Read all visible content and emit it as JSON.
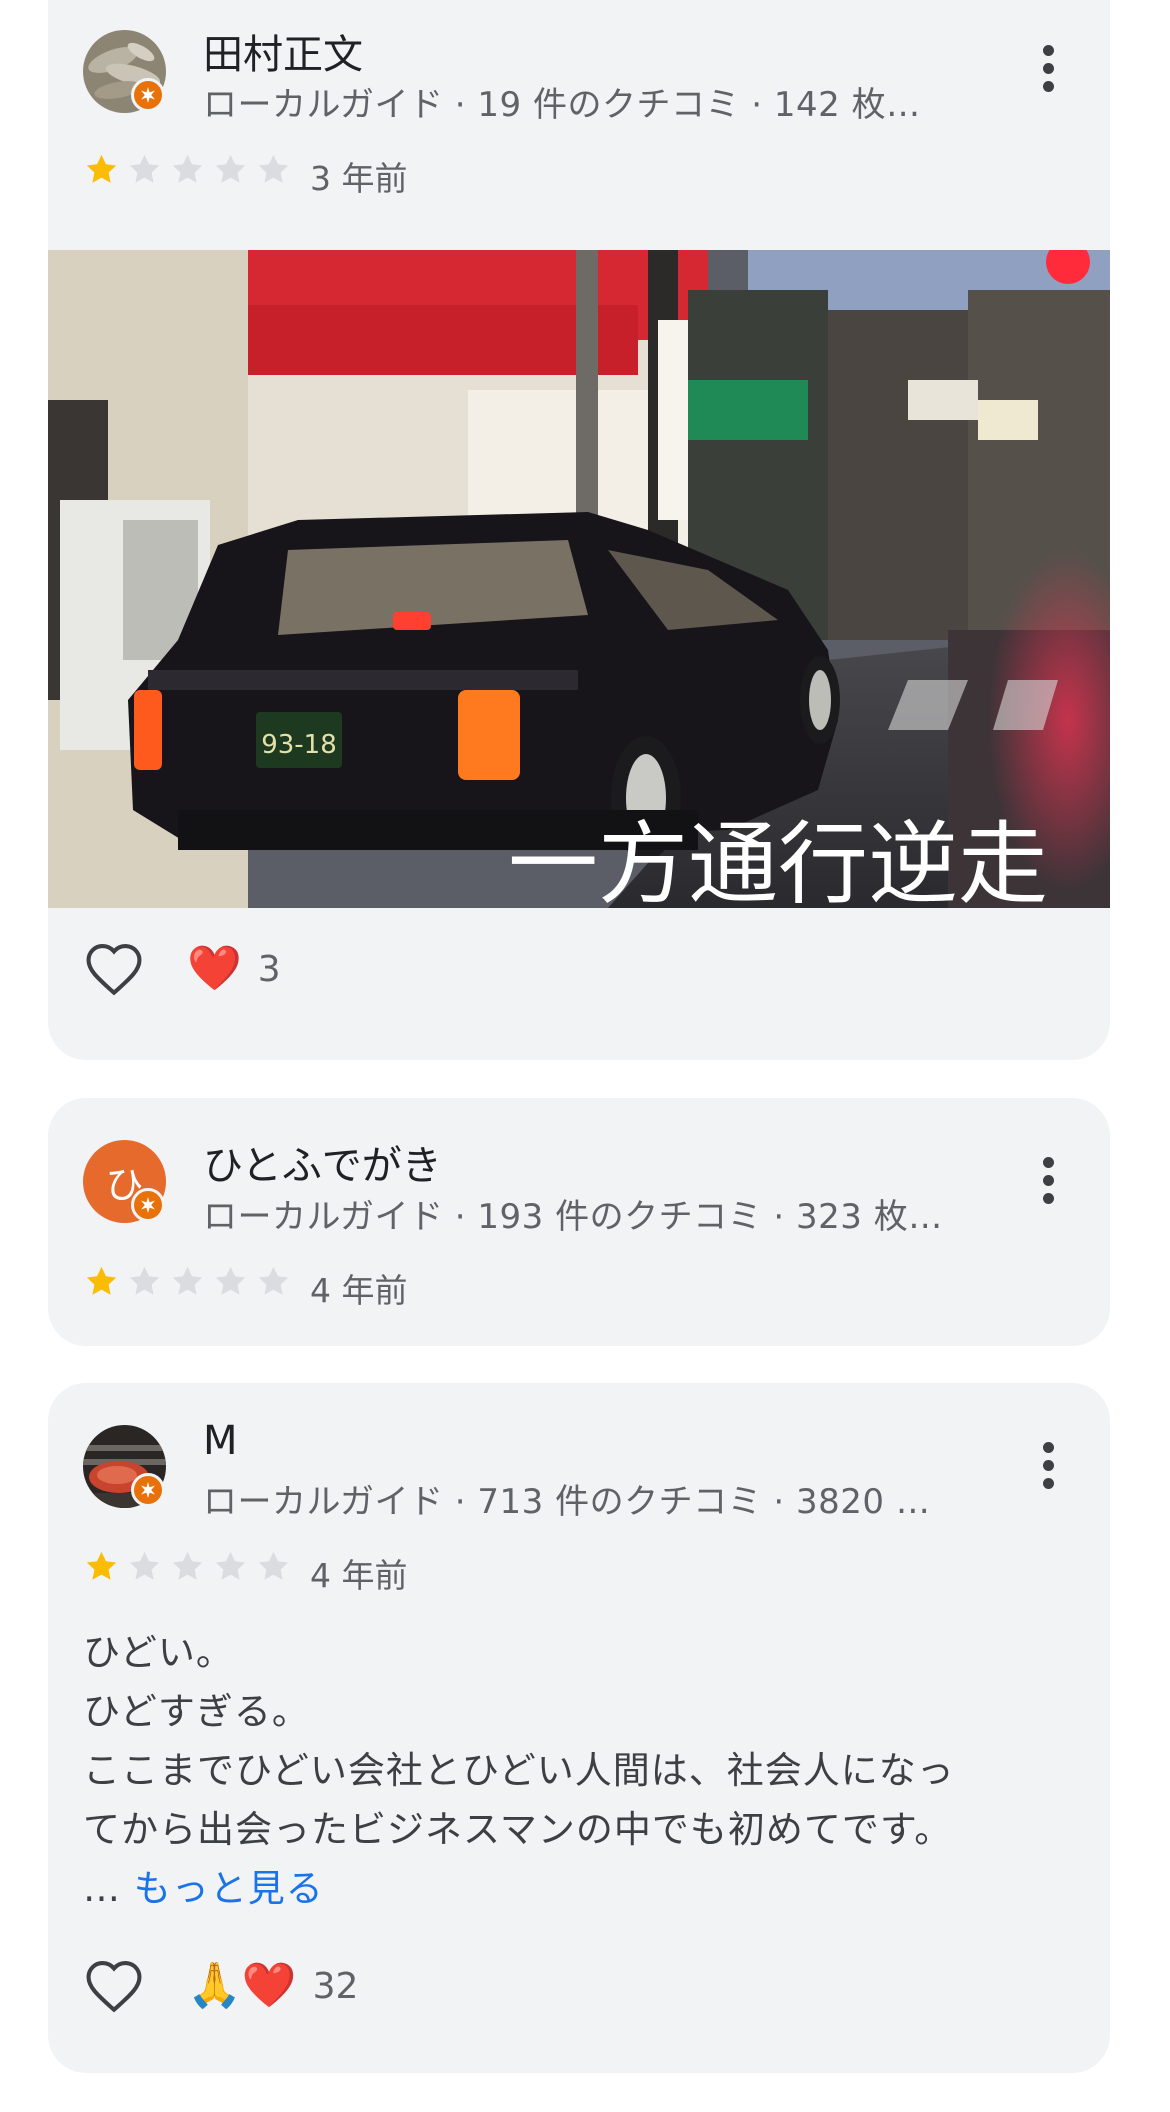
{
  "reviews": [
    {
      "name": "田村正文",
      "meta": "ローカルガイド · 19 件のクチコミ · 142 枚…",
      "rating": 1,
      "age": "3 年前",
      "photo_caption": "一方通行逆走",
      "reaction_emoji": "❤️",
      "reaction_count": "3"
    },
    {
      "name": "ひとふでがき",
      "avatar_letter": "ひ",
      "meta": "ローカルガイド · 193 件のクチコミ · 323 枚…",
      "rating": 1,
      "age": "4 年前"
    },
    {
      "name": "M",
      "meta": "ローカルガイド · 713 件のクチコミ · 3820 …",
      "rating": 1,
      "age": "4 年前",
      "text_lines": [
        "ひどい。",
        "ひどすぎる。",
        "ここまでひどい会社とひどい人間は、社会人になっ",
        "てから出会ったビジネスマンの中でも初めてです。"
      ],
      "ellipsis": "… ",
      "more_label": "もっと見る",
      "reaction_emoji": "🙏❤️",
      "reaction_count": "32"
    }
  ],
  "colors": {
    "card_bg": "#f1f3f4",
    "star_filled": "#fbbc04",
    "star_empty": "#dadce0",
    "local_guide_badge": "#e8710a",
    "link": "#1a73e8"
  }
}
